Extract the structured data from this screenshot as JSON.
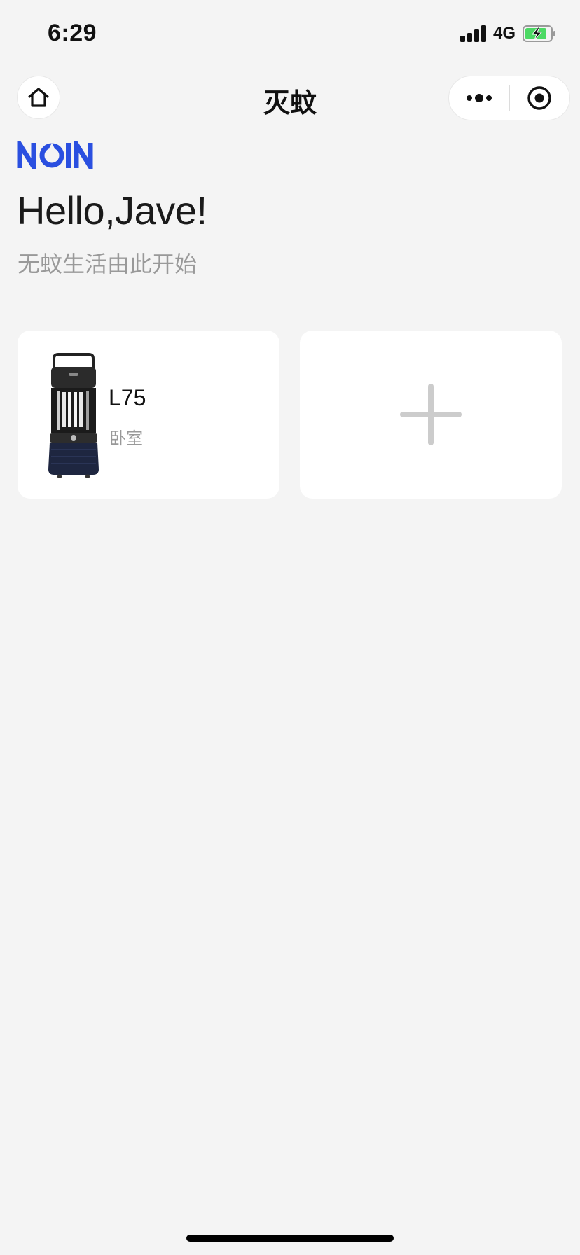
{
  "status_bar": {
    "time": "6:29",
    "network": "4G",
    "battery_color": "#4cd964",
    "icons": [
      "signal-icon",
      "battery-charging-icon"
    ]
  },
  "nav": {
    "title": "灭蚊",
    "home_icon": "home-icon",
    "more_icon": "more-dots-icon",
    "close_icon": "target-close-icon"
  },
  "brand": {
    "logo_text": "NOIN",
    "logo_color": "#2a4fe0"
  },
  "greeting": {
    "headline": "Hello,Jave!",
    "subtitle": "无蚊生活由此开始"
  },
  "devices": [
    {
      "model": "L75",
      "room": "卧室",
      "image": "mosquito-lamp-image"
    }
  ],
  "add_device": {
    "icon": "plus-icon",
    "icon_color": "#cccccc"
  },
  "colors": {
    "page_background": "#f4f4f4",
    "card_background": "#ffffff",
    "secondary_text": "#999999"
  }
}
